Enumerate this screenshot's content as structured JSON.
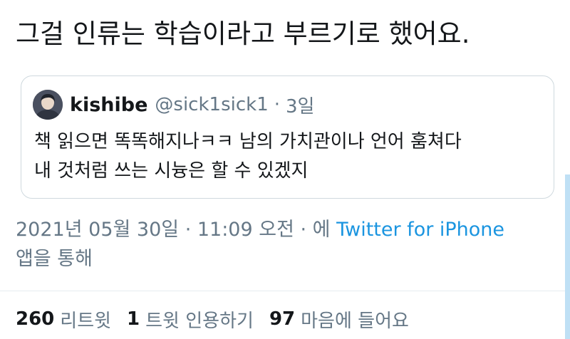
{
  "tweet": {
    "text": "그걸 인류는 학습이라고 부르기로 했어요."
  },
  "quote": {
    "author_name": "kishibe",
    "author_handle": "@sick1sick1",
    "separator": "·",
    "time": "3일",
    "lines": [
      "책 읽으면 똑똑해지나ㅋㅋ 남의 가치관이나 언어 훔쳐다",
      "내 것처럼 쓰는 시늉은 할 수 있겠지"
    ]
  },
  "meta": {
    "date_time": "2021년 05월 30일 · 11:09 오전 · 에 ",
    "source": "Twitter for iPhone",
    "via": "앱을 통해"
  },
  "stats": {
    "retweets_count": "260",
    "retweets_label": "리트윗",
    "quotes_count": "1",
    "quotes_label": "트윗 인용하기",
    "likes_count": "97",
    "likes_label": "마음에 들어요"
  }
}
